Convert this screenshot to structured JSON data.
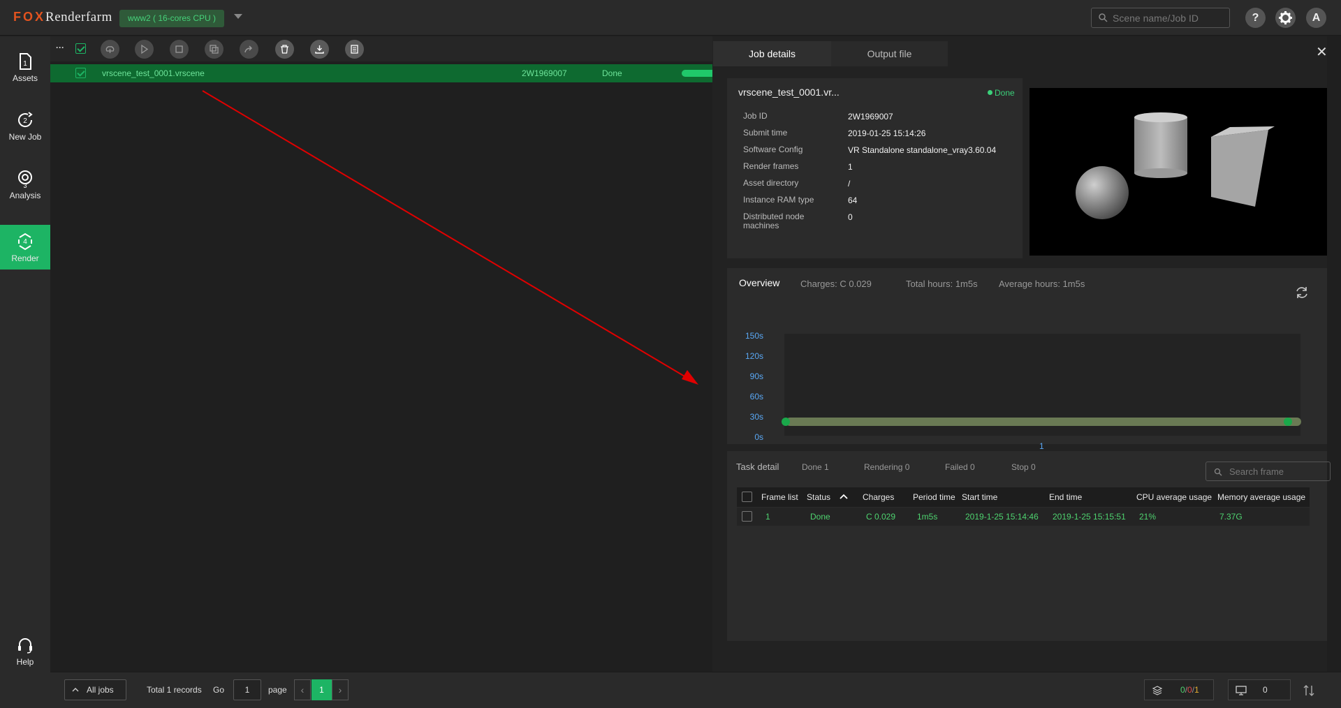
{
  "header": {
    "logo_fox": "FOX",
    "logo_rest": "Renderfarm",
    "cluster": "www2 ( 16-cores CPU )",
    "search_placeholder": "Scene name/Job ID",
    "help_label": "?",
    "avatar_label": "A"
  },
  "sidebar": {
    "items": [
      {
        "label": "Assets",
        "step": "1"
      },
      {
        "label": "New Job",
        "step": "2"
      },
      {
        "label": "Analysis",
        "step": "3"
      },
      {
        "label": "Render",
        "step": "4"
      },
      {
        "label": "Help",
        "step": ""
      }
    ]
  },
  "toolbar": {
    "more": "···"
  },
  "job": {
    "name": "vrscene_test_0001.vrscene",
    "id": "2W1969007",
    "status": "Done"
  },
  "panel": {
    "tabs": [
      "Job details",
      "Output file"
    ],
    "close": "✕",
    "title": "vrscene_test_0001.vr...",
    "status": "Done",
    "fields": [
      {
        "label": "Job ID",
        "value": "2W1969007"
      },
      {
        "label": "Submit time",
        "value": "2019-01-25 15:14:26"
      },
      {
        "label": "Software Config",
        "value": "VR Standalone standalone_vray3.60.04"
      },
      {
        "label": "Render frames",
        "value": "1"
      },
      {
        "label": "Asset directory",
        "value": "/"
      },
      {
        "label": "Instance RAM type",
        "value": "64"
      },
      {
        "label": "Distributed node machines",
        "value": "0"
      }
    ]
  },
  "overview": {
    "title": "Overview",
    "charges": "Charges: C 0.029",
    "total_hours": "Total hours: 1m5s",
    "average_hours": "Average hours: 1m5s"
  },
  "chart_data": {
    "type": "bar",
    "categories": [
      "1"
    ],
    "values": [
      65
    ],
    "ylim": [
      0,
      150
    ],
    "yticks": [
      "150s",
      "120s",
      "90s",
      "60s",
      "30s",
      "0s"
    ]
  },
  "task": {
    "title": "Task detail",
    "done": "Done 1",
    "rendering": "Rendering 0",
    "failed": "Failed 0",
    "stop": "Stop 0",
    "search_placeholder": "Search frame",
    "columns": [
      "Frame list",
      "Status",
      "Charges",
      "Period time",
      "Start time",
      "End time",
      "CPU average usage",
      "Memory average usage"
    ],
    "rows": [
      {
        "frame": "1",
        "status": "Done",
        "charges": "C 0.029",
        "period": "1m5s",
        "start": "2019-1-25 15:14:46",
        "end": "2019-1-25 15:15:51",
        "cpu": "21%",
        "memory": "7.37G"
      }
    ]
  },
  "footer": {
    "all_jobs": "All jobs",
    "total": "Total 1 records",
    "go": "Go",
    "page_input": "1",
    "page_label": "page",
    "current_page": "1",
    "counts_done": "0",
    "counts_failed": "0",
    "counts_total": "1",
    "machines": "0"
  },
  "colors": {
    "accent": "#1db464",
    "brand": "#e2531f",
    "arrow": "#e00000"
  }
}
